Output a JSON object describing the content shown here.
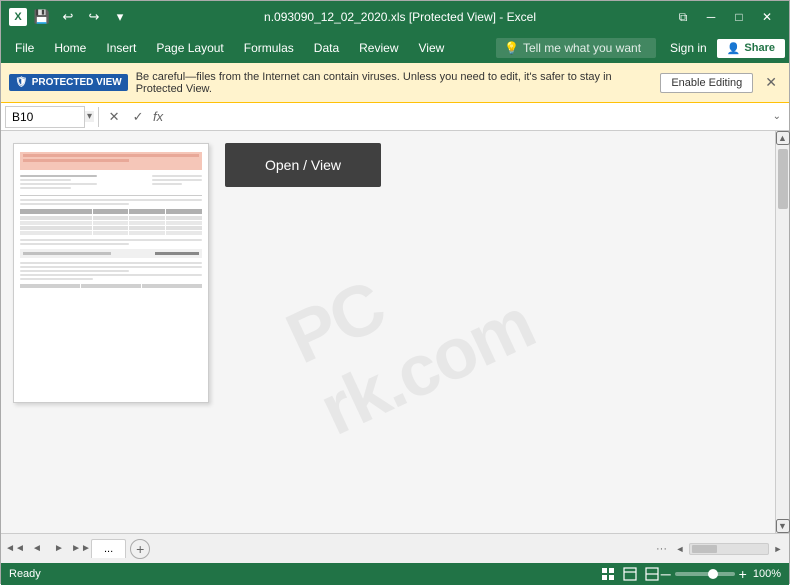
{
  "titleBar": {
    "appIconLabel": "X",
    "title": "n.093090_12_02_2020.xls [Protected View] - Excel",
    "quickAccess": {
      "save": "💾",
      "undo": "↩",
      "redo": "↪",
      "dropdown": "▾"
    },
    "winControls": {
      "restore": "⧉",
      "minimize": "─",
      "maximize": "□",
      "close": "✕"
    }
  },
  "menuBar": {
    "items": [
      "File",
      "Home",
      "Insert",
      "Page Layout",
      "Formulas",
      "Data",
      "Review",
      "View"
    ],
    "tellMe": {
      "placeholder": "Tell me what you want",
      "icon": "💡"
    },
    "signIn": "Sign in",
    "share": {
      "icon": "👤",
      "label": "Share"
    }
  },
  "protectedView": {
    "badge": "PROTECTED VIEW",
    "shieldIcon": "🛡",
    "message": "Be careful—files from the Internet can contain viruses. Unless you need to edit, it's safer to stay in Protected View.",
    "enableEditing": "Enable Editing",
    "close": "✕"
  },
  "formulaBar": {
    "nameBox": "B10",
    "cancelBtn": "✕",
    "confirmBtn": "✓",
    "fxLabel": "fx",
    "value": "",
    "expandIcon": "⌄"
  },
  "mainContent": {
    "openViewButton": "Open / View",
    "watermark": "PC\nrk.com"
  },
  "bottomBar": {
    "navPrev": "◄",
    "navNext": "►",
    "ellipsis": "...",
    "addSheet": "+",
    "scrollLeft": "◄",
    "scrollRight": "►"
  },
  "statusBar": {
    "status": "Ready",
    "viewIcons": [
      "▤",
      "▦",
      "▦"
    ],
    "zoomMinus": "─",
    "zoomPlus": "+",
    "zoomLevel": "100%"
  }
}
